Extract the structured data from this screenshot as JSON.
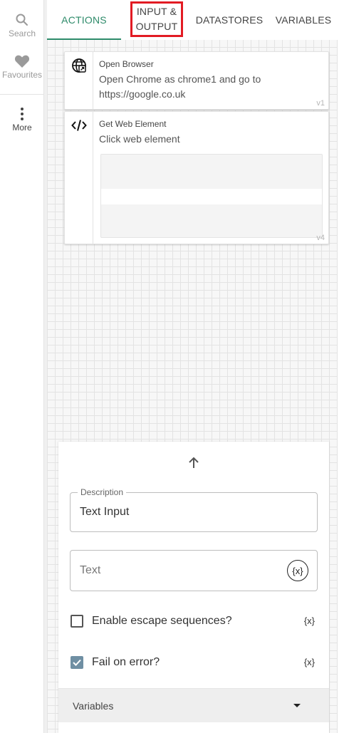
{
  "rail": {
    "items": [
      {
        "label": "Search",
        "icon": "search-icon"
      },
      {
        "label": "Favourites",
        "icon": "heart-icon"
      },
      {
        "label": "More",
        "icon": "more-vertical-icon"
      }
    ]
  },
  "tabs": [
    {
      "label": "ACTIONS",
      "active": true
    },
    {
      "label_line1": "INPUT &",
      "label_line2": "OUTPUT"
    },
    {
      "label": "DATASTORES"
    },
    {
      "label": "VARIABLES"
    }
  ],
  "actions": [
    {
      "title": "Open Browser",
      "description": "Open Chrome as chrome1 and go to https://google.co.uk",
      "version": "v1",
      "icon": "globe-icon"
    },
    {
      "title": "Get Web Element",
      "description": "Click web element",
      "version": "v4",
      "icon": "code-icon"
    }
  ],
  "properties": {
    "description_label": "Description",
    "description_value": "Text Input",
    "text_placeholder": "Text",
    "var_button": "{x}",
    "escape_label": "Enable escape sequences?",
    "escape_checked": false,
    "fail_label": "Fail on error?",
    "fail_checked": true,
    "var_small": "{x}",
    "variables_label": "Variables"
  },
  "colors": {
    "accent": "#2e8b6a",
    "highlight": "#e21b23",
    "checkbox": "#6f8fa3"
  }
}
